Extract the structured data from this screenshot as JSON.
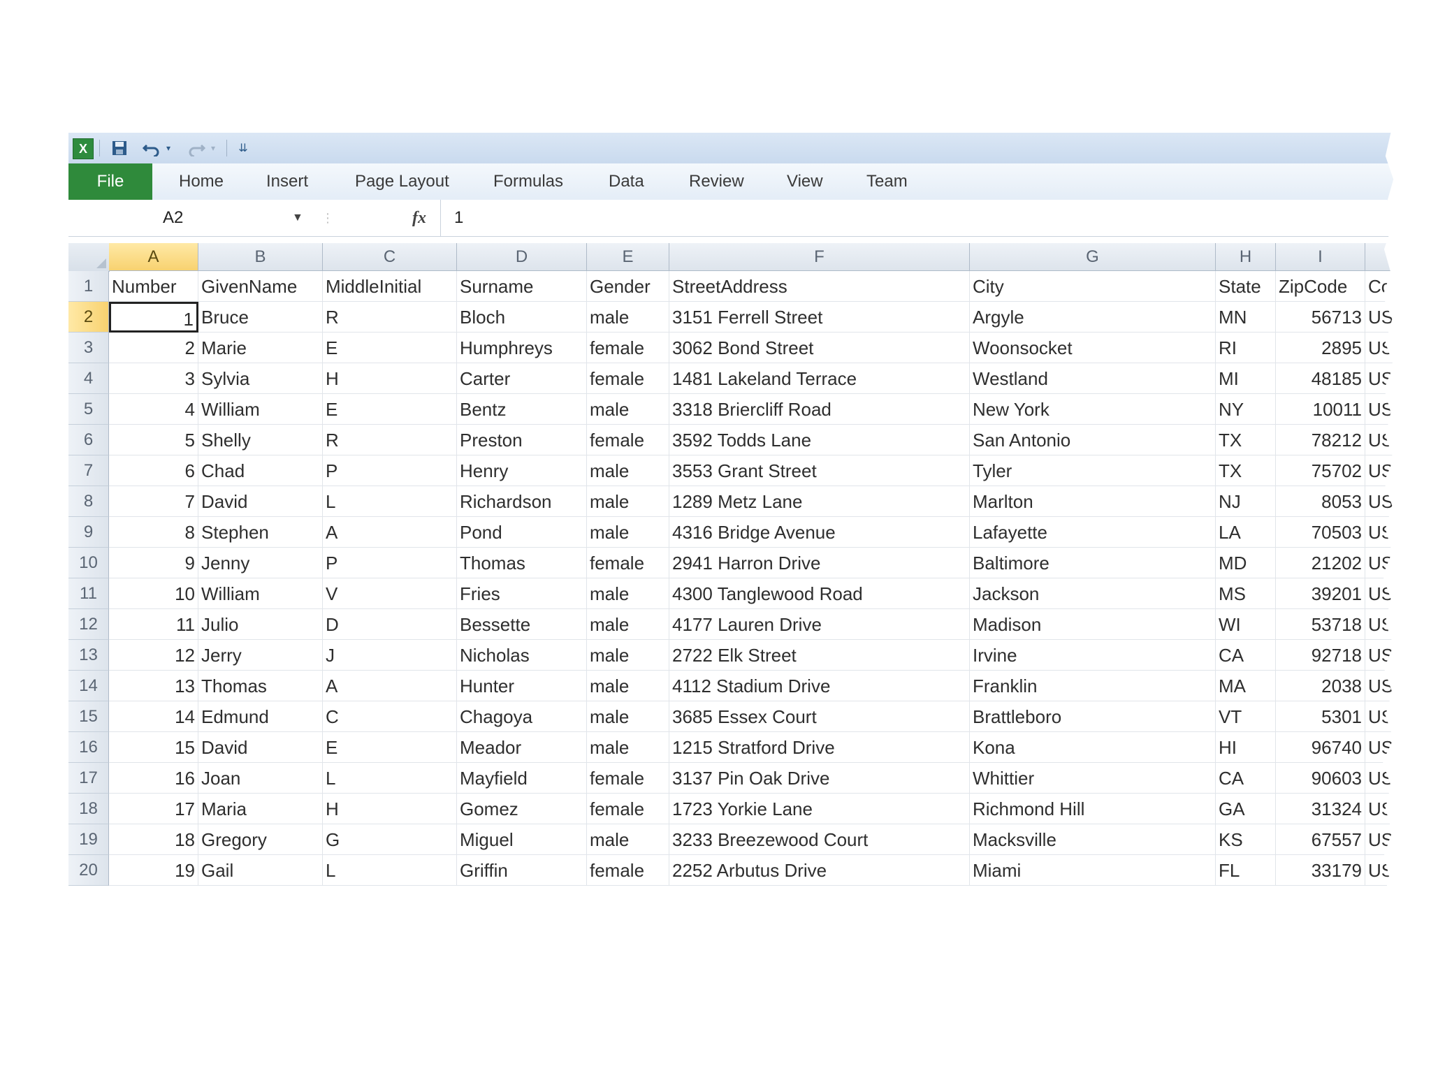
{
  "quick_access": {
    "app_icon_glyph": "X",
    "icons": [
      "excel-icon",
      "save-icon",
      "undo-icon",
      "redo-icon",
      "customize-toolbar-icon"
    ]
  },
  "ribbon": {
    "tabs": [
      "File",
      "Home",
      "Insert",
      "Page Layout",
      "Formulas",
      "Data",
      "Review",
      "View",
      "Team"
    ],
    "active_tab_color": "#2f8a3b"
  },
  "formula_bar": {
    "name_box": "A2",
    "fx_label": "fx",
    "value": "1"
  },
  "sheet": {
    "columns": [
      "A",
      "B",
      "C",
      "D",
      "E",
      "F",
      "G",
      "H",
      "I",
      ""
    ],
    "active_column": "A",
    "active_row": "2",
    "rows": [
      {
        "n": "1",
        "cells": [
          "Number",
          "GivenName",
          "MiddleInitial",
          "Surname",
          "Gender",
          "StreetAddress",
          "City",
          "State",
          "ZipCode",
          "Co"
        ]
      },
      {
        "n": "2",
        "cells": [
          "1",
          "Bruce",
          "R",
          "Bloch",
          "male",
          "3151 Ferrell Street",
          "Argyle",
          "MN",
          "56713",
          "US"
        ]
      },
      {
        "n": "3",
        "cells": [
          "2",
          "Marie",
          "E",
          "Humphreys",
          "female",
          "3062 Bond Street",
          "Woonsocket",
          "RI",
          "2895",
          "US"
        ]
      },
      {
        "n": "4",
        "cells": [
          "3",
          "Sylvia",
          "H",
          "Carter",
          "female",
          "1481 Lakeland Terrace",
          "Westland",
          "MI",
          "48185",
          "US"
        ]
      },
      {
        "n": "5",
        "cells": [
          "4",
          "William",
          "E",
          "Bentz",
          "male",
          "3318 Briercliff Road",
          "New York",
          "NY",
          "10011",
          "US"
        ]
      },
      {
        "n": "6",
        "cells": [
          "5",
          "Shelly",
          "R",
          "Preston",
          "female",
          "3592 Todds Lane",
          "San Antonio",
          "TX",
          "78212",
          "US"
        ]
      },
      {
        "n": "7",
        "cells": [
          "6",
          "Chad",
          "P",
          "Henry",
          "male",
          "3553 Grant Street",
          "Tyler",
          "TX",
          "75702",
          "US"
        ]
      },
      {
        "n": "8",
        "cells": [
          "7",
          "David",
          "L",
          "Richardson",
          "male",
          "1289 Metz Lane",
          "Marlton",
          "NJ",
          "8053",
          "US"
        ]
      },
      {
        "n": "9",
        "cells": [
          "8",
          "Stephen",
          "A",
          "Pond",
          "male",
          "4316 Bridge Avenue",
          "Lafayette",
          "LA",
          "70503",
          "US"
        ]
      },
      {
        "n": "10",
        "cells": [
          "9",
          "Jenny",
          "P",
          "Thomas",
          "female",
          "2941 Harron Drive",
          "Baltimore",
          "MD",
          "21202",
          "US"
        ]
      },
      {
        "n": "11",
        "cells": [
          "10",
          "William",
          "V",
          "Fries",
          "male",
          "4300 Tanglewood Road",
          "Jackson",
          "MS",
          "39201",
          "US"
        ]
      },
      {
        "n": "12",
        "cells": [
          "11",
          "Julio",
          "D",
          "Bessette",
          "male",
          "4177 Lauren Drive",
          "Madison",
          "WI",
          "53718",
          "US"
        ]
      },
      {
        "n": "13",
        "cells": [
          "12",
          "Jerry",
          "J",
          "Nicholas",
          "male",
          "2722 Elk Street",
          "Irvine",
          "CA",
          "92718",
          "US"
        ]
      },
      {
        "n": "14",
        "cells": [
          "13",
          "Thomas",
          "A",
          "Hunter",
          "male",
          "4112 Stadium Drive",
          "Franklin",
          "MA",
          "2038",
          "US"
        ]
      },
      {
        "n": "15",
        "cells": [
          "14",
          "Edmund",
          "C",
          "Chagoya",
          "male",
          "3685 Essex Court",
          "Brattleboro",
          "VT",
          "5301",
          "US"
        ]
      },
      {
        "n": "16",
        "cells": [
          "15",
          "David",
          "E",
          "Meador",
          "male",
          "1215 Stratford Drive",
          "Kona",
          "HI",
          "96740",
          "US"
        ]
      },
      {
        "n": "17",
        "cells": [
          "16",
          "Joan",
          "L",
          "Mayfield",
          "female",
          "3137 Pin Oak Drive",
          "Whittier",
          "CA",
          "90603",
          "US"
        ]
      },
      {
        "n": "18",
        "cells": [
          "17",
          "Maria",
          "H",
          "Gomez",
          "female",
          "1723 Yorkie Lane",
          "Richmond Hill",
          "GA",
          "31324",
          "US"
        ]
      },
      {
        "n": "19",
        "cells": [
          "18",
          "Gregory",
          "G",
          "Miguel",
          "male",
          "3233 Breezewood Court",
          "Macksville",
          "KS",
          "67557",
          "US"
        ]
      },
      {
        "n": "20",
        "cells": [
          "19",
          "Gail",
          "L",
          "Griffin",
          "female",
          "2252 Arbutus Drive",
          "Miami",
          "FL",
          "33179",
          "US"
        ]
      }
    ]
  }
}
